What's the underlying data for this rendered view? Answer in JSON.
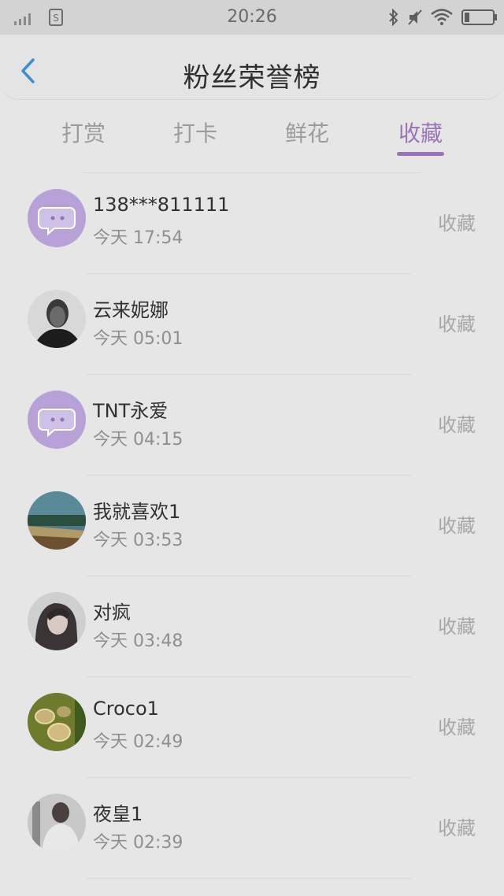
{
  "status_bar": {
    "time": "20:26"
  },
  "header": {
    "title": "粉丝荣誉榜",
    "back_icon": "chevron-left-icon"
  },
  "tabs": [
    {
      "label": "打赏",
      "active": false
    },
    {
      "label": "打卡",
      "active": false
    },
    {
      "label": "鲜花",
      "active": false
    },
    {
      "label": "收藏",
      "active": true
    }
  ],
  "colors": {
    "accent": "#9b74b6",
    "default_avatar": "#b7a1d6"
  },
  "list": [
    {
      "name": "138***811111",
      "time": "今天 17:54",
      "action": "收藏",
      "avatar": "default-chat-avatar"
    },
    {
      "name": "云来妮娜",
      "time": "今天 05:01",
      "action": "收藏",
      "avatar": "photo-avatar"
    },
    {
      "name": "TNT永爱",
      "time": "今天 04:15",
      "action": "收藏",
      "avatar": "default-chat-avatar"
    },
    {
      "name": "我就喜欢1",
      "time": "今天 03:53",
      "action": "收藏",
      "avatar": "photo-avatar"
    },
    {
      "name": "对疯",
      "time": "今天 03:48",
      "action": "收藏",
      "avatar": "photo-avatar"
    },
    {
      "name": "Croco1",
      "time": "今天 02:49",
      "action": "收藏",
      "avatar": "photo-avatar"
    },
    {
      "name": "夜皇1",
      "time": "今天 02:39",
      "action": "收藏",
      "avatar": "photo-avatar"
    }
  ]
}
